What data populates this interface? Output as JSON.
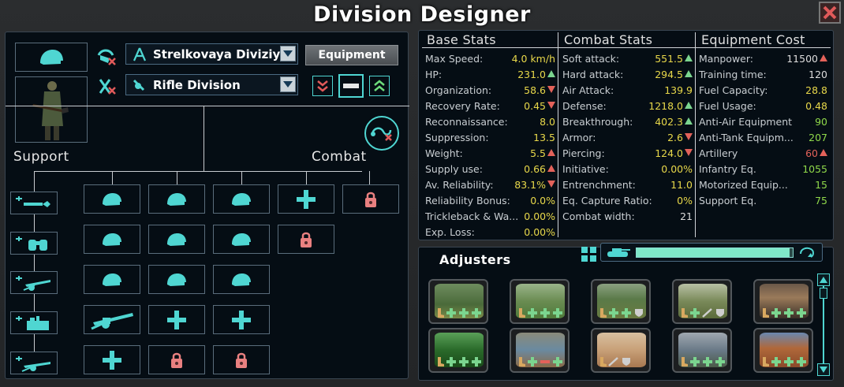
{
  "window": {
    "title": "Division Designer"
  },
  "template": {
    "name": "Strelkovaya Diviziya",
    "role": "Rifle Division",
    "equipment_button": "Equipment"
  },
  "labels": {
    "support": "Support",
    "combat": "Combat",
    "adjusters": "Adjusters"
  },
  "base_stats": {
    "header": "Base Stats",
    "rows": [
      {
        "label": "Max Speed:",
        "value": "4.0 km/h",
        "trend": "none",
        "color": "yellow"
      },
      {
        "label": "HP:",
        "value": "231.0",
        "trend": "up",
        "color": "yellow"
      },
      {
        "label": "Organization:",
        "value": "58.6",
        "trend": "down",
        "color": "yellow"
      },
      {
        "label": "Recovery Rate:",
        "value": "0.45",
        "trend": "down",
        "color": "yellow"
      },
      {
        "label": "Reconnaissance:",
        "value": "8.0",
        "trend": "none",
        "color": "yellow"
      },
      {
        "label": "Suppression:",
        "value": "13.5",
        "trend": "none",
        "color": "yellow"
      },
      {
        "label": "Weight:",
        "value": "5.5",
        "trend": "upred",
        "color": "yellow"
      },
      {
        "label": "Supply use:",
        "value": "0.66",
        "trend": "upred",
        "color": "yellow"
      },
      {
        "label": "Av. Reliability:",
        "value": "83.1%",
        "trend": "down",
        "color": "yellow"
      },
      {
        "label": "Reliability Bonus:",
        "value": "0.0%",
        "trend": "none",
        "color": "yellow"
      },
      {
        "label": "Trickleback & Wa...",
        "value": "0.00%",
        "trend": "none",
        "color": "yellow"
      },
      {
        "label": "Exp. Loss:",
        "value": "0.00%",
        "trend": "none",
        "color": "yellow"
      }
    ]
  },
  "combat_stats": {
    "header": "Combat Stats",
    "rows": [
      {
        "label": "Soft attack:",
        "value": "551.5",
        "trend": "up",
        "color": "yellow"
      },
      {
        "label": "Hard attack:",
        "value": "294.5",
        "trend": "up",
        "color": "yellow"
      },
      {
        "label": "Air Attack:",
        "value": "139.9",
        "trend": "none",
        "color": "yellow"
      },
      {
        "label": "Defense:",
        "value": "1218.0",
        "trend": "up",
        "color": "yellow"
      },
      {
        "label": "Breakthrough:",
        "value": "402.3",
        "trend": "up",
        "color": "yellow"
      },
      {
        "label": "Armor:",
        "value": "2.6",
        "trend": "down",
        "color": "yellow"
      },
      {
        "label": "Piercing:",
        "value": "124.0",
        "trend": "down",
        "color": "yellow"
      },
      {
        "label": "Initiative:",
        "value": "0.00%",
        "trend": "none",
        "color": "yellow"
      },
      {
        "label": "Entrenchment:",
        "value": "11.0",
        "trend": "none",
        "color": "yellow"
      },
      {
        "label": "Eq. Capture Ratio:",
        "value": "0%",
        "trend": "none",
        "color": "yellow"
      },
      {
        "label": "Combat width:",
        "value": "21",
        "trend": "none",
        "color": "white"
      }
    ]
  },
  "equipment_cost": {
    "header": "Equipment Cost",
    "rows": [
      {
        "label": "Manpower:",
        "value": "11500",
        "trend": "upred",
        "color": "white"
      },
      {
        "label": "Training time:",
        "value": "120",
        "trend": "none",
        "color": "white"
      },
      {
        "label": "Fuel Capacity:",
        "value": "28.8",
        "trend": "none",
        "color": "yellow"
      },
      {
        "label": "Fuel Usage:",
        "value": "0.48",
        "trend": "none",
        "color": "yellow"
      },
      {
        "label": "Anti-Air Equipment",
        "value": "90",
        "trend": "none",
        "color": "green"
      },
      {
        "label": "Anti-Tank Equipm...",
        "value": "207",
        "trend": "none",
        "color": "green"
      },
      {
        "label": "Artillery",
        "value": "60",
        "trend": "upred",
        "color": "red"
      },
      {
        "label": "Infantry Eq.",
        "value": "1055",
        "trend": "none",
        "color": "green"
      },
      {
        "label": "Motorized Equip...",
        "value": "15",
        "trend": "none",
        "color": "green"
      },
      {
        "label": "Support Eq.",
        "value": "75",
        "trend": "none",
        "color": "green"
      }
    ]
  },
  "support_slots": [
    "engineer",
    "recon",
    "artillery",
    "anti-air",
    "anti-tank"
  ],
  "combat_grid": [
    [
      "infantry",
      "infantry",
      "infantry",
      "add",
      "locked"
    ],
    [
      "infantry",
      "infantry",
      "infantry",
      "locked"
    ],
    [
      "infantry",
      "infantry",
      "infantry"
    ],
    [
      "artillery",
      "add",
      "add"
    ],
    [
      "add",
      "locked",
      "locked"
    ]
  ],
  "adjusters": {
    "progress": 0.98,
    "tiles": [
      {
        "terrain": "forest-hills",
        "mods": [
          "plus",
          "plus",
          "plus"
        ]
      },
      {
        "terrain": "plains",
        "mods": [
          "plus",
          "plus",
          "plus"
        ]
      },
      {
        "terrain": "mountain",
        "mods": [
          "plus",
          "plus",
          "shield"
        ]
      },
      {
        "terrain": "marsh",
        "mods": [
          "plus",
          "sword",
          "shield"
        ]
      },
      {
        "terrain": "urban",
        "mods": [
          "plus",
          "plus",
          "plus"
        ]
      },
      {
        "terrain": "jungle",
        "mods": [
          "plus",
          "plus",
          "plus"
        ]
      },
      {
        "terrain": "river",
        "mods": [
          "plus",
          "minus",
          "plus"
        ]
      },
      {
        "terrain": "desert",
        "mods": [
          "sword",
          "shield"
        ]
      },
      {
        "terrain": "mountain-valley",
        "mods": [
          "plus",
          "plus",
          "plus"
        ]
      },
      {
        "terrain": "badlands",
        "mods": [
          "plus",
          "plus",
          "plus"
        ]
      }
    ]
  },
  "colors": {
    "accent": "#4fd6d2",
    "panel_bg": "#050d14",
    "value_yellow": "#e8d84a",
    "value_green": "#8fd84a",
    "value_red": "#e3625a",
    "lock": "#e98080"
  }
}
